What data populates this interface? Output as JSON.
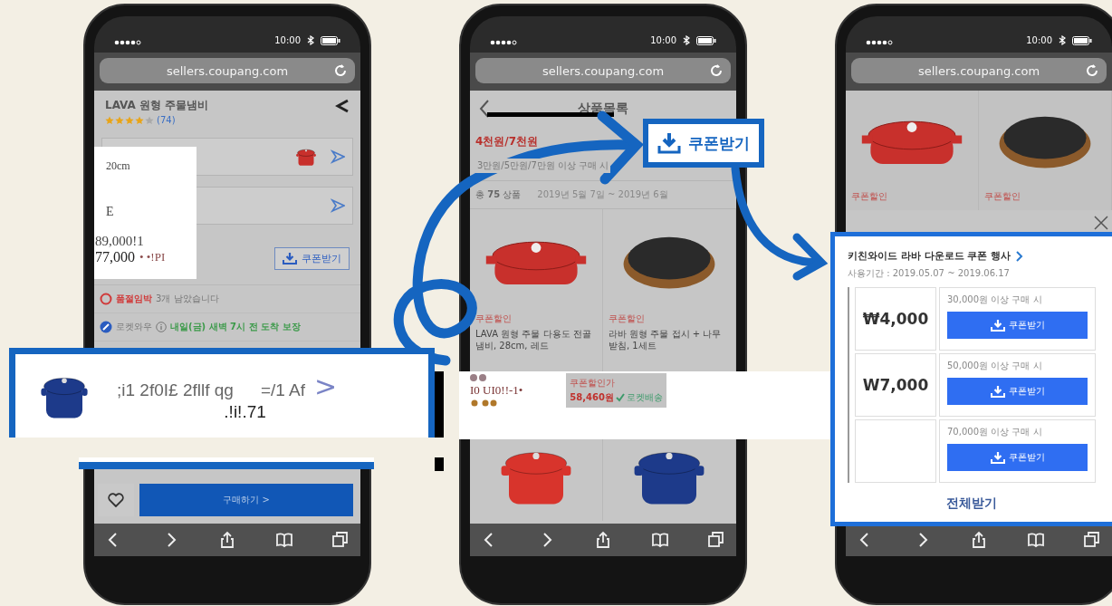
{
  "phones": [
    {
      "kind": "product",
      "time": "10:00",
      "url": "sellers.coupang.com",
      "title": "LAVA 원형 주물냄비",
      "stars": 4,
      "review_count": "(74)",
      "overlay_lines": [
        "20cm",
        "E",
        "89,000!1"
      ],
      "overlay_price": "77,000",
      "overlay_suffix": "• •!PI",
      "coupon_button": "쿠폰받기",
      "stock_label": "품절임박",
      "stock_text": "3개 남았습니다",
      "delivery_label": "로켓와우",
      "delivery_text": "내일(금) 새벽 7시 전 도착 보장",
      "buy_button": "구매하기 >",
      "highlight_card": {
        "text_1": ";i1 2f0I£ 2fllf qg",
        "text_2": "=/1 Af",
        "chevron": ">",
        "text_3": ".!i!.71"
      }
    },
    {
      "kind": "list",
      "time": "10:00",
      "url": "sellers.coupang.com",
      "title": "상품목록",
      "heading": "4천원/7천원",
      "subheading": "3만원/5만원/7만원 이상 구매 시",
      "count": "총 **75** 상품",
      "date_range": "2019년 5월 7일 ~ 2019년 6월",
      "products": [
        {
          "kind": "casserole",
          "color": "#c8302c",
          "tag": "쿠폰할인",
          "name": "LAVA 원형 주물 다용도 전골냄비, 28cm, 레드"
        },
        {
          "kind": "pan",
          "color": "#2a2a2a",
          "tag": "쿠폰할인",
          "name": "라바 원형 주물 접시 + 나무받침, 1세트"
        },
        {
          "kind": "cocotte",
          "color": "#d8342c"
        },
        {
          "kind": "cocotte",
          "color": "#1d3a8a"
        }
      ],
      "strip_text": "I0 UI0!!-1•",
      "sale_label": "쿠폰할인가",
      "sale_price": "58,460원",
      "shipping": "로켓배송",
      "callout_button": "쿠폰받기"
    },
    {
      "kind": "coupon",
      "time": "10:00",
      "url": "sellers.coupang.com",
      "products": [
        {
          "kind": "casserole",
          "color": "#c8302c",
          "tag": "쿠폰할인"
        },
        {
          "kind": "pan",
          "color": "#2a2a2a",
          "tag": "쿠폰할인"
        }
      ],
      "panel": {
        "title": "키친와이드 라바 다운로드 쿠폰 행사",
        "period": "사용기간 : 2019.05.07 ~ 2019.06.17",
        "coupons": [
          {
            "amount": "₩4,000",
            "condition": "30,000원 이상 구매 시",
            "button": "쿠폰받기"
          },
          {
            "amount": "W7,000",
            "condition": "50,000원 이상 구매 시",
            "button": "쿠폰받기"
          },
          {
            "condition": "70,000원 이상 구매 시",
            "button": "쿠폰받기"
          }
        ],
        "all_button": "전체받기"
      }
    }
  ]
}
